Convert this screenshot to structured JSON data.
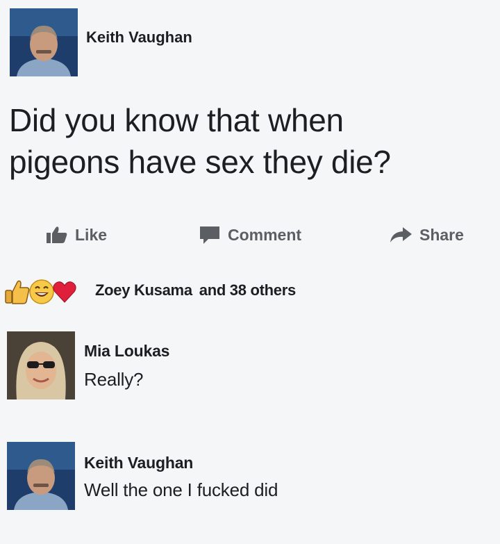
{
  "post": {
    "author": "Keith Vaughan",
    "text": "Did you know that when\npigeons have sex they die?"
  },
  "actions": {
    "like": "Like",
    "comment": "Comment",
    "share": "Share"
  },
  "reactions": {
    "name": "Zoey Kusama",
    "others": "and 38 others"
  },
  "comments": [
    {
      "author": "Mia Loukas",
      "text": "Really?"
    },
    {
      "author": "Keith Vaughan",
      "text": "Well the one I fucked did"
    }
  ],
  "colors": {
    "background": "#f5f6f8",
    "action_gray": "#5b5e63",
    "heart": "#e0203b",
    "haha": "#f7c948",
    "like_thumb": "#e5a93a"
  }
}
